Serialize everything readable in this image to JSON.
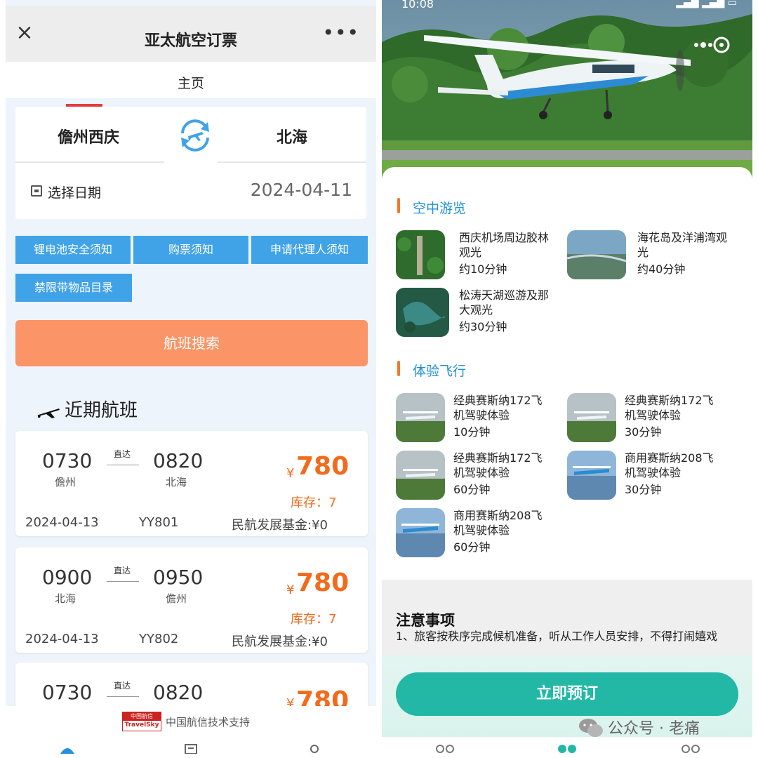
{
  "left": {
    "header": {
      "title": "亚太航空订票",
      "close_icon": "close-icon",
      "more_icon": "more-icon"
    },
    "subtab": "主页",
    "route": {
      "from": "儋州西庆",
      "to": "北海",
      "date_label": "选择日期",
      "date_value": "2024-04-11"
    },
    "notices": [
      "锂电池安全须知",
      "购票须知",
      "申请代理人须知",
      "禁限带物品目录"
    ],
    "search_button": "航班搜索",
    "recent_title": "近期航班",
    "flights": [
      {
        "dep_time": "0730",
        "dep_city": "儋州",
        "arr_time": "0820",
        "arr_city": "北海",
        "direct": "直达",
        "currency": "¥",
        "price": "780",
        "stock": "库存：7",
        "date": "2024-04-13",
        "code": "YY801",
        "fund": "民航发展基金:¥0"
      },
      {
        "dep_time": "0900",
        "dep_city": "北海",
        "arr_time": "0950",
        "arr_city": "儋州",
        "direct": "直达",
        "currency": "¥",
        "price": "780",
        "stock": "库存：7",
        "date": "2024-04-13",
        "code": "YY802",
        "fund": "民航发展基金:¥0"
      },
      {
        "dep_time": "0730",
        "dep_city": "",
        "arr_time": "0820",
        "arr_city": "",
        "direct": "直达",
        "currency": "¥",
        "price": "780",
        "stock": "",
        "date": "",
        "code": "",
        "fund": ""
      }
    ],
    "footer": {
      "logo_top": "中国航信",
      "logo_bottom": "TravelSky",
      "text": "中国航信技术支持"
    },
    "accent_color": "#fb9466",
    "notice_color": "#41a3e7"
  },
  "right": {
    "status": {
      "time": "10:08"
    },
    "sections": [
      {
        "title": "空中游览",
        "items": [
          {
            "name": "西庆机场周边胶林观光",
            "duration": "约10分钟"
          },
          {
            "name": "海花岛及洋浦湾观光",
            "duration": "约40分钟"
          },
          {
            "name": "松涛天湖巡游及那大观光",
            "duration": "约30分钟"
          }
        ]
      },
      {
        "title": "体验飞行",
        "items": [
          {
            "name": "经典赛斯纳172飞机驾驶体验",
            "duration": "10分钟"
          },
          {
            "name": "经典赛斯纳172飞机驾驶体验",
            "duration": "30分钟"
          },
          {
            "name": "经典赛斯纳172飞机驾驶体验",
            "duration": "60分钟"
          },
          {
            "name": "商用赛斯纳208飞机驾驶体验",
            "duration": "30分钟"
          },
          {
            "name": "商用赛斯纳208飞机驾驶体验",
            "duration": "60分钟"
          }
        ]
      }
    ],
    "notes": {
      "title": "注意事项",
      "text": "1、旅客按秩序完成候机准备，听从工作人员安排，不得打闹嬉戏"
    },
    "book_button": "立即预订",
    "watermark": "公众号 · 老痛",
    "accent_color": "#22b8a5",
    "section_color": "#2291d6"
  }
}
